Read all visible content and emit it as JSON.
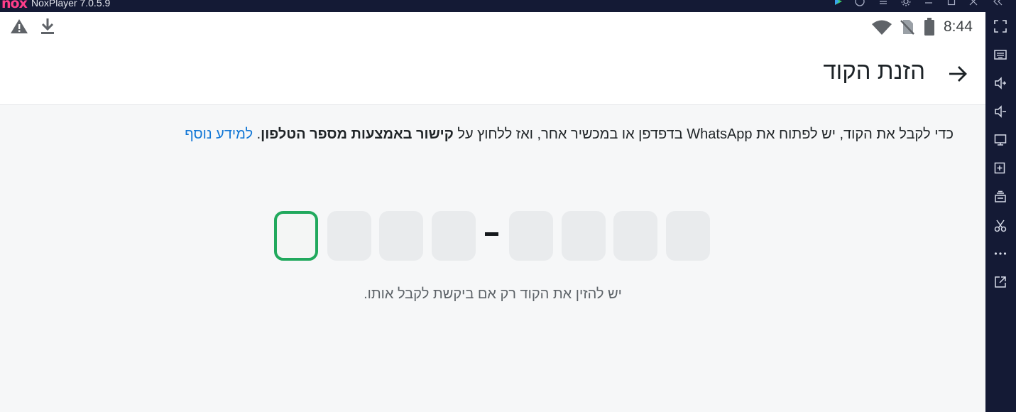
{
  "window": {
    "logo": "nox",
    "title": "NoxPlayer 7.0.5.9",
    "controls": [
      "play-store-icon",
      "help-icon",
      "menu-icon",
      "settings-icon",
      "minimize-icon",
      "maximize-icon",
      "close-icon",
      "collapse-icon"
    ]
  },
  "status_bar": {
    "left_icons": [
      "warning-icon",
      "download-icon"
    ],
    "right_icons": [
      "wifi-icon",
      "no-sim-icon",
      "battery-icon"
    ],
    "time": "8:44"
  },
  "app_bar": {
    "title": "הזנת הקוד",
    "back_icon": "arrow-back-icon"
  },
  "instructions": {
    "text_part1": "כדי לקבל את הקוד, יש לפתוח את WhatsApp בדפדפן או במכשיר אחר, ואז ללחוץ על ",
    "bold_text": "קישור באמצעות מספר הטלפון",
    "text_part2": ".",
    "link_text": "למידע נוסף"
  },
  "code_input": {
    "boxes": 8,
    "separator": "-",
    "values": [
      "",
      "",
      "",
      "",
      "",
      "",
      "",
      ""
    ],
    "active_index": 0
  },
  "note": "יש להזין את הקוד רק אם ביקשת לקבל אותו.",
  "sidebar_tools": [
    "fullscreen-icon",
    "keyboard-icon",
    "volume-up-icon",
    "volume-down-icon",
    "screen-icon",
    "add-apk-icon",
    "multi-instance-icon",
    "screenshot-cut-icon",
    "more-icon",
    "popout-icon"
  ],
  "colors": {
    "accent_green": "#21a95d",
    "link_blue": "#1277d6",
    "nox_dark": "#141a35"
  }
}
